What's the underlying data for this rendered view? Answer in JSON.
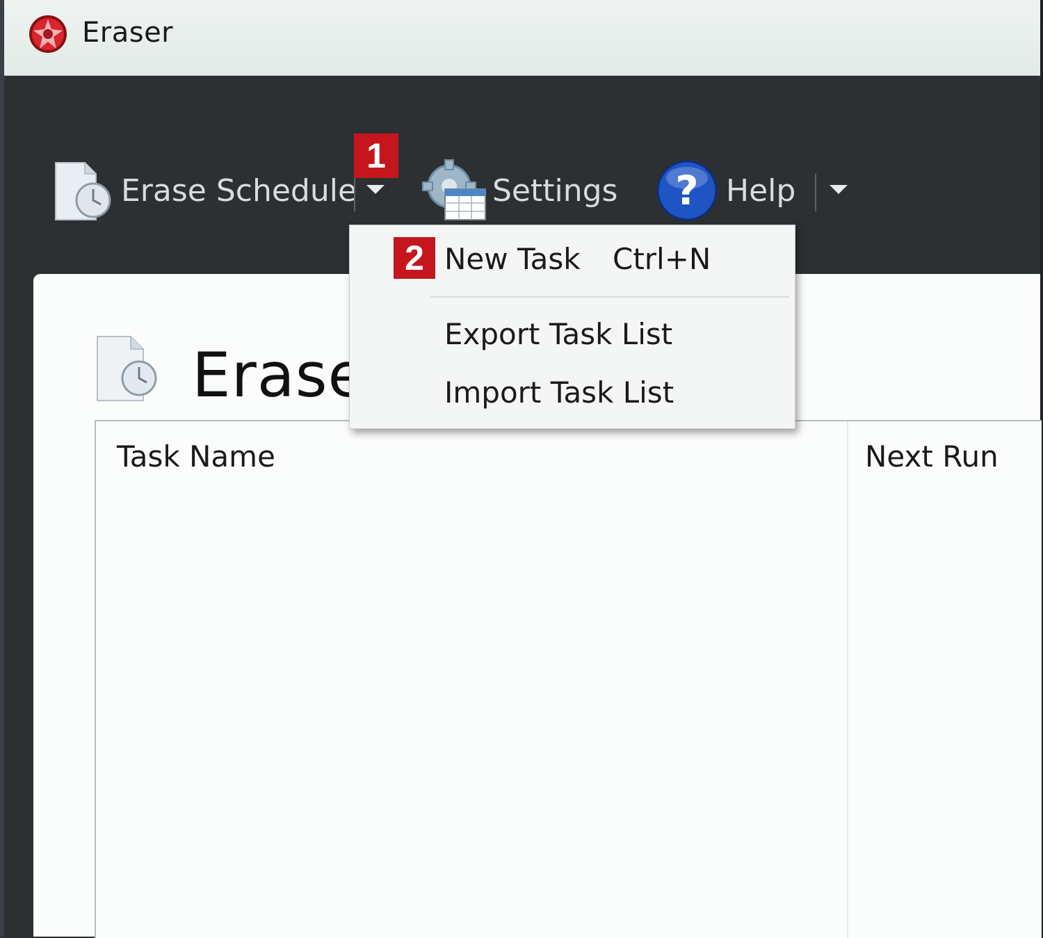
{
  "window": {
    "title": "Eraser"
  },
  "toolbar": {
    "erase_schedule_label": "Erase Schedule",
    "settings_label": "Settings",
    "help_label": "Help"
  },
  "annotations": {
    "step1": "1",
    "step2": "2"
  },
  "menu": {
    "items": [
      {
        "label": "New Task",
        "shortcut": "Ctrl+N"
      },
      {
        "label": "Export Task List"
      },
      {
        "label": "Import Task List"
      }
    ]
  },
  "panel": {
    "title": "Erase"
  },
  "task_list": {
    "columns": [
      "Task Name",
      "Next Run"
    ]
  },
  "colors": {
    "badge": "#c4161c",
    "toolbar_bg": "#2d3033",
    "titlebar_bg": "#e7eeea",
    "panel_bg": "#fbfcfc"
  }
}
